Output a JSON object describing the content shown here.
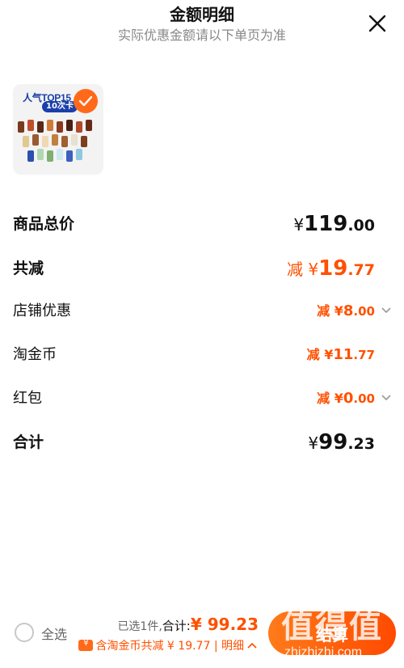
{
  "header": {
    "title": "金额明细",
    "subtitle": "实际优惠金额请以下单页为准"
  },
  "product": {
    "thumb_title": "人气TOP15",
    "thumb_pill": "10次卡",
    "checked": true
  },
  "rows": [
    {
      "label": "商品总价",
      "prefix": "",
      "currency": "¥",
      "int": "119",
      "dec": ".00",
      "expandable": false
    },
    {
      "label": "共减",
      "prefix": "减 ",
      "currency": "¥",
      "int": "19",
      "dec": ".77",
      "expandable": false
    },
    {
      "label": "店铺优惠",
      "prefix": "减 ",
      "currency": "¥",
      "int": "8",
      "dec": ".00",
      "expandable": true
    },
    {
      "label": "淘金币",
      "prefix": "减 ",
      "currency": "¥",
      "int": "11",
      "dec": ".77",
      "expandable": false
    },
    {
      "label": "红包",
      "prefix": "减 ",
      "currency": "¥",
      "int": "0",
      "dec": ".00",
      "expandable": true
    },
    {
      "label": "合计",
      "prefix": "",
      "currency": "¥",
      "int": "99",
      "dec": ".23",
      "expandable": false
    }
  ],
  "footer": {
    "select_all": "全选",
    "selected_count": "已选1件,",
    "total_label": "合计:",
    "total_value": "¥ 99.23",
    "coins_note": "含淘金币共减 ¥ 19.77 | 明细",
    "checkout_label": "结算"
  },
  "watermark": {
    "text": "值得值",
    "url": "zhizhizhi.com"
  },
  "colors": {
    "accent": "#ff5000",
    "checkout_start": "#ff7a1a",
    "checkout_end": "#ff4a00"
  }
}
